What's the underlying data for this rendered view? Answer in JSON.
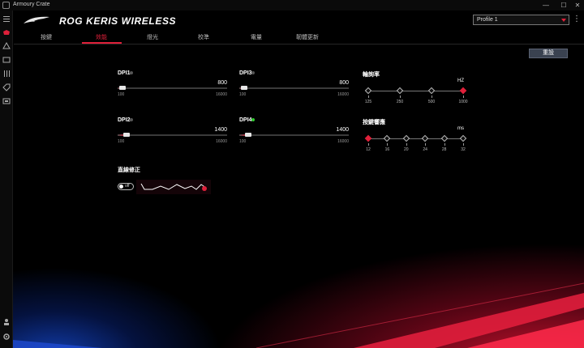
{
  "window": {
    "title": "Armoury Crate",
    "minimize": "—",
    "maximize": "☐",
    "close": "✕"
  },
  "header": {
    "product": "ROG KERIS WIRELESS",
    "profile": "Profile 1",
    "more": "⋮"
  },
  "tabs": [
    {
      "label": "按鍵",
      "active": false
    },
    {
      "label": "效能",
      "active": true
    },
    {
      "label": "燈光",
      "active": false
    },
    {
      "label": "校準",
      "active": false
    },
    {
      "label": "電量",
      "active": false
    },
    {
      "label": "韌體更新",
      "active": false
    }
  ],
  "reset_label": "重設",
  "dpi": [
    {
      "label": "DPI1",
      "value": "800",
      "min": "100",
      "max": "16000",
      "fraction": 0.044,
      "enabled": false
    },
    {
      "label": "DPI2",
      "value": "1400",
      "min": "100",
      "max": "16000",
      "fraction": 0.082,
      "enabled": false
    },
    {
      "label": "DPI3",
      "value": "800",
      "min": "100",
      "max": "16000",
      "fraction": 0.044,
      "enabled": false
    },
    {
      "label": "DPI4",
      "value": "1400",
      "min": "100",
      "max": "16000",
      "fraction": 0.082,
      "enabled": true
    }
  ],
  "polling": {
    "label": "輪詢率",
    "unit": "HZ",
    "options": [
      "125",
      "250",
      "500",
      "1000"
    ],
    "selected_index": 3
  },
  "debounce": {
    "label": "按鍵響應",
    "unit": "ms",
    "options": [
      "12",
      "16",
      "20",
      "24",
      "28",
      "32"
    ],
    "selected_index": 0
  },
  "angle_snapping": {
    "label": "直線修正",
    "toggle_text": "off",
    "enabled": false
  },
  "colors": {
    "accent": "#e0203a",
    "enabled_dot": "#33cc33",
    "disabled_dot": "#555555"
  }
}
